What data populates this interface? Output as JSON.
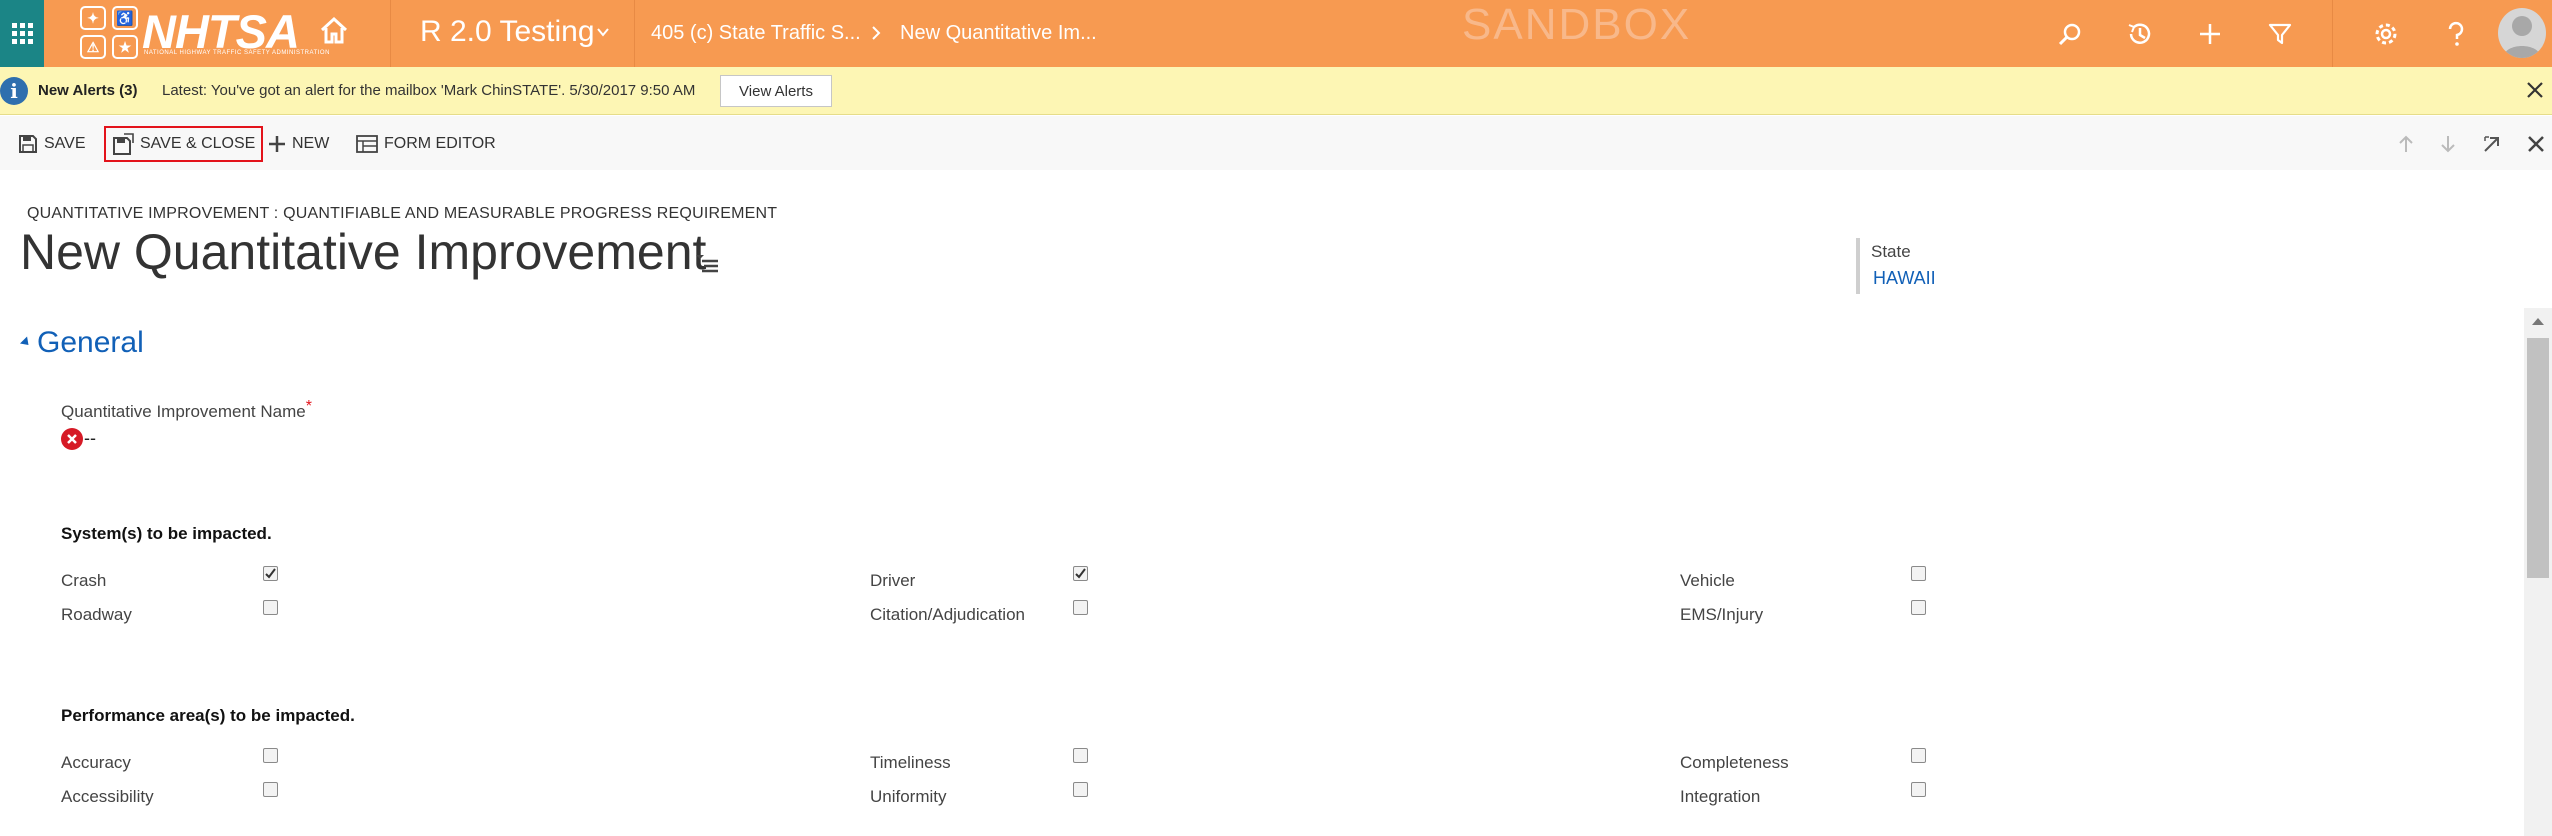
{
  "nav": {
    "logo_text": "NHTSA",
    "logo_subtext": "NATIONAL HIGHWAY TRAFFIC SAFETY ADMINISTRATION",
    "area": "R 2.0 Testing",
    "breadcrumb_1": "405 (c) State Traffic S...",
    "breadcrumb_2": "New Quantitative Im...",
    "environment": "SANDBOX",
    "bar_color": "#f79a51",
    "apps_color": "#1b8586",
    "icons": [
      "apps-grid-icon",
      "home-icon",
      "chevron-down-icon",
      "search-icon",
      "history-icon",
      "plus-icon",
      "filter-icon",
      "gear-icon",
      "help-icon",
      "user-icon"
    ]
  },
  "alert": {
    "title": "New Alerts (3)",
    "message": "Latest: You've got an alert for the mailbox 'Mark ChinSTATE'. 5/30/2017 9:50 AM",
    "button": "View Alerts"
  },
  "toolbar": {
    "save": "SAVE",
    "save_close": "SAVE & CLOSE",
    "new": "NEW",
    "form_editor": "FORM EDITOR"
  },
  "form": {
    "entity_type": "QUANTITATIVE IMPROVEMENT : QUANTIFIABLE AND MEASURABLE PROGRESS REQUIREMENT",
    "title": "New Quantitative Improvement",
    "header_field_label": "State",
    "header_field_value": "HAWAII",
    "accent_color": "#1160b7"
  },
  "section": {
    "title": "General",
    "name_label": "Quantitative Improvement Name",
    "required_mark": "*",
    "name_value": "--"
  },
  "systems": {
    "heading": "System(s) to be impacted.",
    "items": [
      {
        "label": "Crash",
        "checked": true
      },
      {
        "label": "Driver",
        "checked": true
      },
      {
        "label": "Vehicle",
        "checked": false
      },
      {
        "label": "Roadway",
        "checked": false
      },
      {
        "label": "Citation/Adjudication",
        "checked": false
      },
      {
        "label": "EMS/Injury",
        "checked": false
      }
    ]
  },
  "performance": {
    "heading": "Performance area(s) to be impacted.",
    "items": [
      {
        "label": "Accuracy",
        "checked": false
      },
      {
        "label": "Timeliness",
        "checked": false
      },
      {
        "label": "Completeness",
        "checked": false
      },
      {
        "label": "Accessibility",
        "checked": false
      },
      {
        "label": "Uniformity",
        "checked": false
      },
      {
        "label": "Integration",
        "checked": false
      }
    ]
  }
}
